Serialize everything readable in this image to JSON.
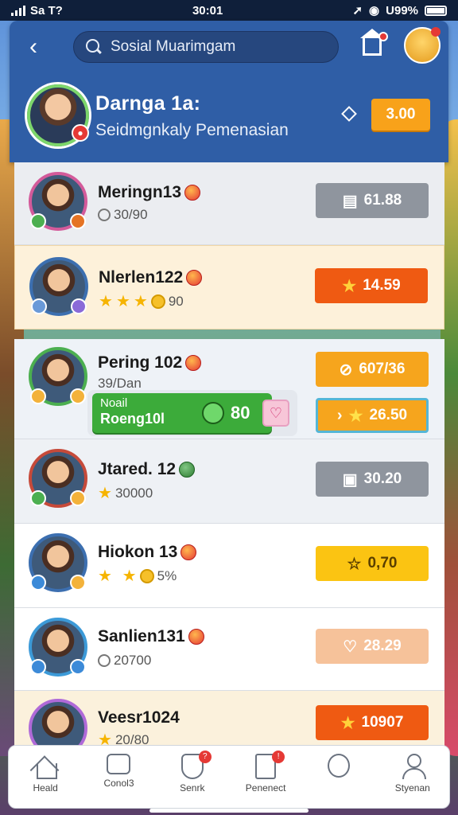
{
  "status_bar": {
    "carrier": "Sa T?",
    "time": "30:01",
    "battery": "U99%"
  },
  "header": {
    "search_placeholder": "Sosial Muarimgam",
    "profile_name": "Darnga 1a:",
    "profile_subtitle": "Seidmgnkaly Pemenasian",
    "coins": "3.00"
  },
  "rows": [
    {
      "name": "Meringn13",
      "sub": "30/90",
      "value": "61.88",
      "value_icon": "clipboard-icon"
    },
    {
      "name": "Nlerlen122",
      "sub": "90",
      "value": "14.59",
      "value_icon": "star-icon"
    },
    {
      "name": "Pering 102",
      "sub": "39/Dan",
      "value": "607/36",
      "value_icon": "tag-icon"
    },
    {
      "name": "Jtared. 12",
      "sub": "30000",
      "value": "30.20",
      "value_icon": "box-icon"
    },
    {
      "name": "Hiokon 13",
      "sub": "5%",
      "value": "0,70",
      "value_icon": "star-icon"
    },
    {
      "name": "Sanlien131",
      "sub": "20700",
      "value": "28.29",
      "value_icon": "heart-icon"
    },
    {
      "name": "Veesr1024",
      "sub": "20/80",
      "value": "10907",
      "value_icon": "star-icon"
    }
  ],
  "promo": {
    "line1": "Noail",
    "line2": "Roeng10l",
    "number": "80",
    "action_value": "26.50"
  },
  "nav": [
    {
      "label": "Heald",
      "icon": "home-icon"
    },
    {
      "label": "Conol3",
      "icon": "box-icon"
    },
    {
      "label": "Senrk",
      "icon": "shield-icon",
      "badge": "?"
    },
    {
      "label": "Penenect",
      "icon": "document-icon",
      "badge": "!"
    },
    {
      "label": "",
      "icon": "face-icon"
    },
    {
      "label": "Styenan",
      "icon": "user-icon"
    }
  ],
  "colors": {
    "header": "#2f5ea6",
    "accent": "#f8a21a",
    "promo": "#3cab3a"
  }
}
